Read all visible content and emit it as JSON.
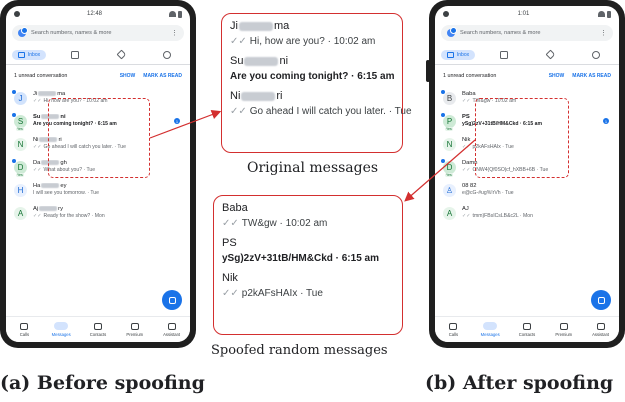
{
  "status": {
    "time_before": "12:48",
    "time_after": "1:01"
  },
  "search": {
    "placeholder": "Search numbers, names & more"
  },
  "tabs": {
    "inbox": "Inbox"
  },
  "unread": {
    "text": "1 unread conversation",
    "show": "SHOW",
    "mark": "MARK AS READ"
  },
  "before": {
    "conversations": [
      {
        "initial": "J",
        "name_a": "Ji",
        "name_b": "ma",
        "msg": "Hi, how are you? · 10:02 am",
        "color": "#d2e3fc",
        "fg": "#1967d2",
        "dot": true,
        "bold": false,
        "sent": true
      },
      {
        "initial": "S",
        "name_a": "Su",
        "name_b": "ni",
        "msg": "Are you coming tonight? · 6:15 am",
        "color": "#ceead6",
        "fg": "#137333",
        "dot": true,
        "bold": true,
        "tag": "Yes",
        "badge": true
      },
      {
        "initial": "N",
        "name_a": "Ni",
        "name_b": "ri",
        "msg": "Go ahead I will catch you later. · Tue",
        "color": "#e6f4ea",
        "fg": "#137333",
        "dot": false,
        "bold": false,
        "sent": true
      },
      {
        "initial": "D",
        "name_a": "Da",
        "name_b": "gh",
        "msg": "What about you? · Tue",
        "color": "#ceead6",
        "fg": "#137333",
        "dot": true,
        "bold": false,
        "tag": "Yes",
        "sent": true
      },
      {
        "initial": "H",
        "name_a": "Ha",
        "name_b": "ey",
        "msg": "I will see you tomorrow. · Tue",
        "color": "#e8f0fe",
        "fg": "#1967d2",
        "dot": false,
        "bold": false
      },
      {
        "initial": "A",
        "name_a": "Aj",
        "name_b": "ry",
        "msg": "Ready for the show? · Mon",
        "color": "#e6f4ea",
        "fg": "#137333",
        "dot": false,
        "bold": false,
        "sent": true
      }
    ]
  },
  "after": {
    "conversations": [
      {
        "initial": "B",
        "name": "Baba",
        "msg": "TW&gw · 10:02 am",
        "color": "#e8eaed",
        "fg": "#3c4043",
        "dot": true,
        "bold": false,
        "sent": true
      },
      {
        "initial": "P",
        "name": "PS",
        "msg": "ySg)2zV+31tB/HM&Ckd · 6:15 am",
        "color": "#ceead6",
        "fg": "#137333",
        "dot": true,
        "bold": true,
        "tag": "Yes",
        "badge": true
      },
      {
        "initial": "N",
        "name": "Nik",
        "msg": "p2kAFsHAIx · Tue",
        "color": "#e6f4ea",
        "fg": "#137333",
        "dot": false,
        "bold": false,
        "sent": true
      },
      {
        "initial": "D",
        "name": "Damn",
        "msg": "CNW4(Qf0SO|cf_hXBB+6B · Tue",
        "color": "#ceead6",
        "fg": "#137333",
        "dot": true,
        "bold": false,
        "tag": "Yes",
        "sent": true
      },
      {
        "initial": "♙",
        "name": "08 82",
        "msg": "e@cG-#ug%!rVh · Tue",
        "color": "#e8f0fe",
        "fg": "#1967d2",
        "dot": false,
        "bold": false
      },
      {
        "initial": "A",
        "name": "AJ",
        "msg": "tmm)FBsICsLB&c2L · Mon",
        "color": "#e6f4ea",
        "fg": "#137333",
        "dot": false,
        "bold": false,
        "sent": true
      }
    ]
  },
  "nav": [
    "Calls",
    "Messages",
    "Contacts",
    "Premium",
    "Assistant"
  ],
  "zoom_original": [
    {
      "name_a": "Ji",
      "name_b": "ma",
      "msg": "Hi, how are you? · 10:02 am",
      "bold": false,
      "sent": true
    },
    {
      "name_a": "Su",
      "name_b": "ni",
      "msg": "Are you coming tonight? · 6:15 am",
      "bold": true,
      "sent": false
    },
    {
      "name_a": "Ni",
      "name_b": "ri",
      "msg": "Go ahead I will catch you later. · Tue",
      "bold": false,
      "sent": true
    }
  ],
  "zoom_spoofed": [
    {
      "name": "Baba",
      "msg": "TW&gw · 10:02 am",
      "bold": false,
      "sent": true
    },
    {
      "name": "PS",
      "msg": "ySg)2zV+31tB/HM&Ckd · 6:15 am",
      "bold": true,
      "sent": false
    },
    {
      "name": "Nik",
      "msg": "p2kAFsHAIx · Tue",
      "bold": false,
      "sent": true
    }
  ],
  "captions": {
    "original": "Original messages",
    "spoofed": "Spoofed random messages",
    "a": "(a) Before spoofing",
    "b": "(b) After spoofing"
  },
  "colors": {
    "accent": "#1a73e8",
    "highlight": "#d32f2f"
  }
}
